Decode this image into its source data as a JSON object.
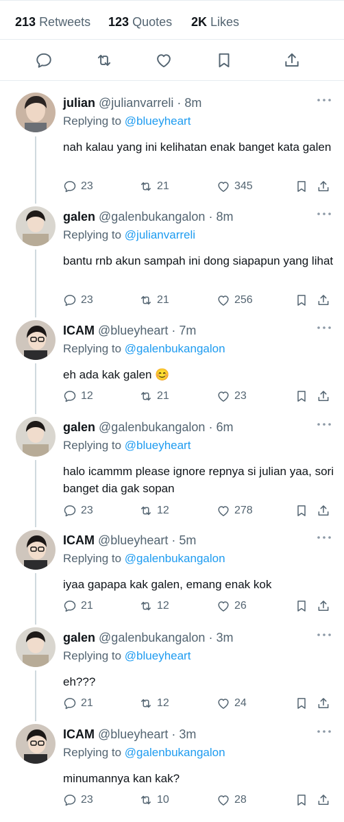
{
  "stats": {
    "retweets_num": "213",
    "retweets_label": "Retweets",
    "quotes_num": "123",
    "quotes_label": "Quotes",
    "likes_num": "2K",
    "likes_label": "Likes"
  },
  "colors": {
    "link": "#1d9bf0",
    "secondary": "#536471",
    "text": "#0f1419",
    "divider": "#e6ecf0"
  },
  "icons": {
    "reply": "comment-icon",
    "retweet": "retweet-icon",
    "like": "heart-icon",
    "bookmark": "bookmark-icon",
    "share": "share-icon",
    "more": "more-icon"
  },
  "replying_to_label": "Replying to",
  "replies": [
    {
      "name": "julian",
      "handle": "@julianvarreli",
      "time": "· 8m",
      "to": "@blueyheart",
      "text": "nah kalau yang ini kelihatan enak banget kata galen",
      "reply_count": "23",
      "retweet_count": "21",
      "like_count": "345"
    },
    {
      "name": "galen",
      "handle": "@galenbukangalon",
      "time": "· 8m",
      "to": "@julianvarreli",
      "text": "bantu rnb akun sampah ini dong siapapun yang lihat",
      "reply_count": "23",
      "retweet_count": "21",
      "like_count": "256"
    },
    {
      "name": "ICAM",
      "handle": "@blueyheart",
      "time": "· 7m",
      "to": "@galenbukangalon",
      "text": "eh ada kak galen 😊",
      "reply_count": "12",
      "retweet_count": "21",
      "like_count": "23"
    },
    {
      "name": "galen",
      "handle": "@galenbukangalon",
      "time": "· 6m",
      "to": "@blueyheart",
      "text": "halo icammm please ignore repnya si julian yaa, sori banget dia gak sopan",
      "reply_count": "23",
      "retweet_count": "12",
      "like_count": "278"
    },
    {
      "name": "ICAM",
      "handle": "@blueyheart",
      "time": "· 5m",
      "to": "@galenbukangalon",
      "text": "iyaa gapapa kak galen, emang enak kok",
      "reply_count": "21",
      "retweet_count": "12",
      "like_count": "26"
    },
    {
      "name": "galen",
      "handle": "@galenbukangalon",
      "time": "· 3m",
      "to": "@blueyheart",
      "text": "eh???",
      "reply_count": "21",
      "retweet_count": "12",
      "like_count": "24"
    },
    {
      "name": "ICAM",
      "handle": "@blueyheart",
      "time": "· 3m",
      "to": "@galenbukangalon",
      "text": "minumannya kan kak?",
      "reply_count": "23",
      "retweet_count": "10",
      "like_count": "28"
    }
  ]
}
